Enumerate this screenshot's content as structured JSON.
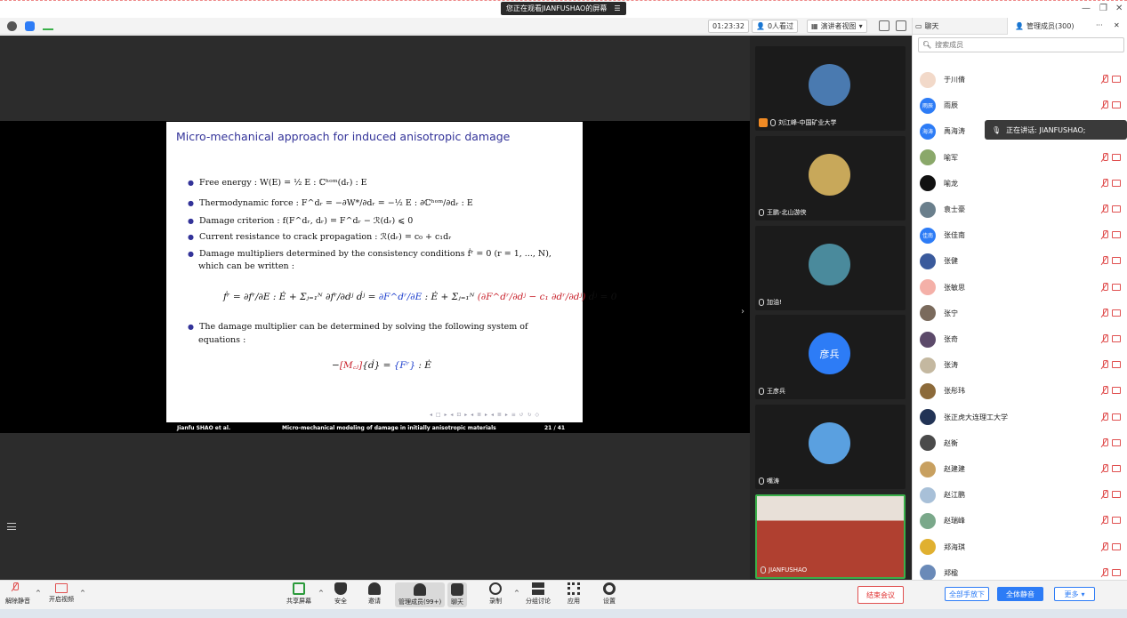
{
  "share_banner": {
    "text": "您正在观看JIANFUSHAO的屏幕",
    "menu_icon": "list-icon"
  },
  "meeting_bar": {
    "timer": "01:23:32",
    "viewers": "0人看过",
    "view_mode": "演讲者视图",
    "view_mode_caret": "▾"
  },
  "panel": {
    "chat_tab": "聊天",
    "members_tab": "管理成员(300)",
    "more": "···",
    "close": "✕",
    "search_placeholder": "搜索成员",
    "members": [
      {
        "name": "于川倩",
        "avatar_text": "",
        "color": "#f2d9c9"
      },
      {
        "name": "雨辰",
        "avatar_text": "雨辰",
        "color": "#2d7cf6"
      },
      {
        "name": "禹海涛",
        "avatar_text": "海涛",
        "color": "#2d7cf6"
      },
      {
        "name": "喻军",
        "avatar_text": "",
        "color": "#8aa86a"
      },
      {
        "name": "喻龙",
        "avatar_text": "",
        "color": "#111111"
      },
      {
        "name": "袁士豪",
        "avatar_text": "",
        "color": "#6a7f8c"
      },
      {
        "name": "张佳南",
        "avatar_text": "佳南",
        "color": "#2d7cf6"
      },
      {
        "name": "张健",
        "avatar_text": "",
        "color": "#3a5a9c"
      },
      {
        "name": "张敏思",
        "avatar_text": "",
        "color": "#f4b0a8"
      },
      {
        "name": "张宁",
        "avatar_text": "",
        "color": "#7a6a5c"
      },
      {
        "name": "张奇",
        "avatar_text": "",
        "color": "#5c4a6a"
      },
      {
        "name": "张涛",
        "avatar_text": "",
        "color": "#c4b8a0"
      },
      {
        "name": "张彤玮",
        "avatar_text": "",
        "color": "#8c6a3a"
      },
      {
        "name": "张正虎大连理工大学",
        "avatar_text": "",
        "color": "#223355"
      },
      {
        "name": "赵衡",
        "avatar_text": "",
        "color": "#4a4a4a"
      },
      {
        "name": "赵建建",
        "avatar_text": "",
        "color": "#c8a060"
      },
      {
        "name": "赵江鹏",
        "avatar_text": "",
        "color": "#a8c0d8"
      },
      {
        "name": "赵瑞峰",
        "avatar_text": "",
        "color": "#7aa88a"
      },
      {
        "name": "郑海琪",
        "avatar_text": "",
        "color": "#e0b030"
      },
      {
        "name": "郑楹",
        "avatar_text": "",
        "color": "#6a8ab8"
      }
    ],
    "speaking": "正在讲话: JIANFUSHAO;",
    "raise_hands_down": "全部手放下",
    "mute_all": "全体静音",
    "more_btn": "更多",
    "more_caret": "▾"
  },
  "gallery": [
    {
      "name": "刘江峰-中国矿业大学",
      "avatar_text": "",
      "color": "#4a7ab0",
      "host": true
    },
    {
      "name": "王鹏-北山游侠",
      "avatar_text": "",
      "color": "#c8a85a",
      "host": false
    },
    {
      "name": "加油!",
      "avatar_text": "",
      "color": "#4a8a9c",
      "host": false
    },
    {
      "name": "王彦兵",
      "avatar_text": "彦兵",
      "color": "#2d7cf6",
      "host": false
    },
    {
      "name": "嘴涛",
      "avatar_text": "",
      "color": "#5aa0e0",
      "host": false
    },
    {
      "name": "JIANFUSHAO",
      "avatar_text": "",
      "color": "#b04030",
      "host": false
    }
  ],
  "slide": {
    "title": "Micro-mechanical approach for induced anisotropic damage",
    "bullets": [
      "Free energy : W(E) = ½ E : ℂʰᵒᵐ(dᵣ) : E",
      "Thermodynamic force : F^dᵣ = −∂W*/∂dᵣ = −½ E : ∂ℂʰᵒᵐ/∂dᵣ : E",
      "Damage criterion : f(F^dᵣ, dᵣ) = F^dᵣ − ℛ(dᵣ) ⩽ 0",
      "Current resistance to crack propagation : ℛ(dᵣ) = c₀ + c₁dᵣ",
      "Damage multipliers determined by the consistency conditions ḟʳ = 0 (r = 1, ..., N),",
      "which can be written :",
      "The damage multiplier can be determined by solving the following system of",
      "equations :"
    ],
    "eq1_a": "ḟʳ = ∂fʳ/∂E : Ė + Σⱼ₌₁ᴺ ∂fʳ/∂dʲ ḋʲ = ",
    "eq1_b": "∂F^dʳ/∂E",
    "eq1_c": " : Ė + Σⱼ₌₁ᴺ ",
    "eq1_d": "(∂F^dʳ/∂dʲ − c₁ ∂dʳ/∂dʲ)",
    "eq1_e": " ḋʲ = 0",
    "eq2_a": "−",
    "eq2_b": "[M꜀ⱼ]",
    "eq2_c": "{ḋ} = ",
    "eq2_d": "{Fʳ}",
    "eq2_e": " : Ė",
    "nav": "◂ □ ▸ ◂ ⊡ ▸ ◂ ≣ ▸ ◂ ≣ ▸   ≡   ↺ ↻ ◇",
    "footer_author": "Jianfu SHAO et al.",
    "footer_title": "Micro-mechanical modeling of damage in initially anisotropic materials",
    "footer_page": "21 / 41"
  },
  "bottom_bar": {
    "unmute": "解除静音",
    "video": "开启视频",
    "share": "共享屏幕",
    "security": "安全",
    "invite": "邀请",
    "members": "管理成员(99+)",
    "chat": "聊天",
    "record": "录制",
    "breakout": "分组讨论",
    "apps": "应用",
    "settings": "设置",
    "end": "结束会议",
    "caret": "^"
  },
  "colors": {
    "accent": "#2d7cf6",
    "danger": "#e03030",
    "slide_blue": "#333399"
  }
}
